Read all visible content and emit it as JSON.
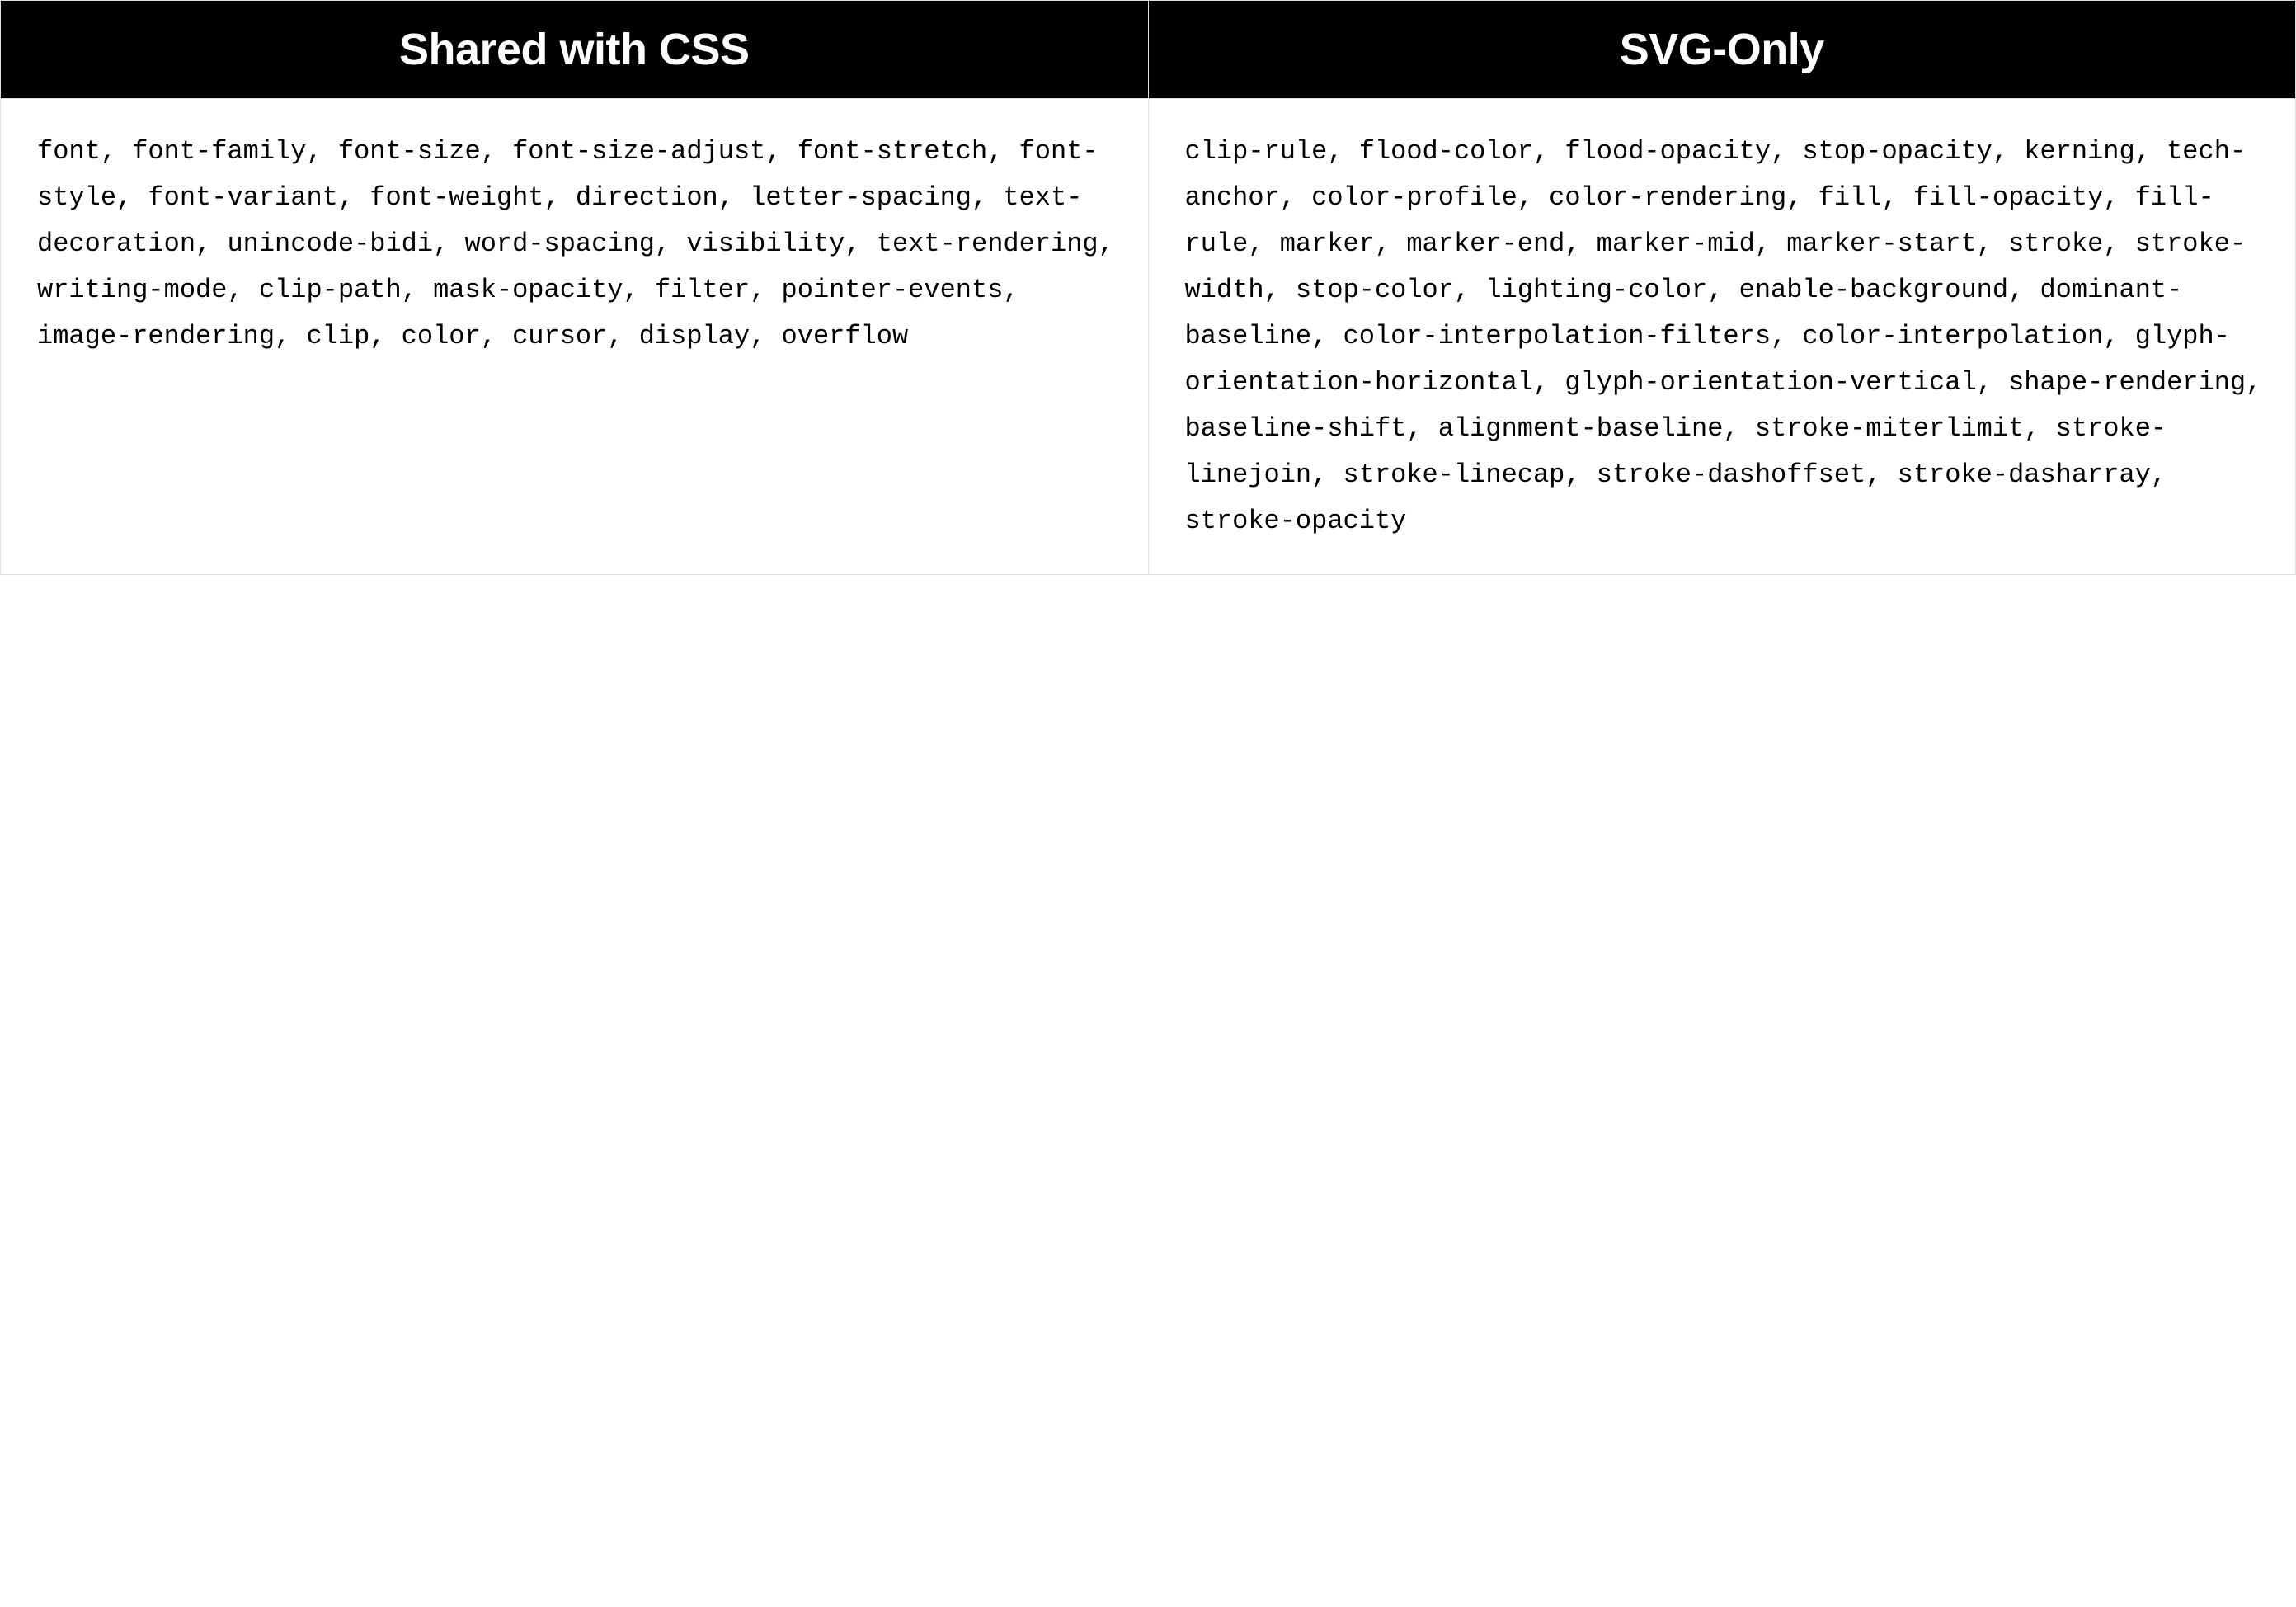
{
  "table": {
    "columns": [
      {
        "header": "Shared with CSS",
        "body": "font, font-family, font-size, font-size-adjust, font-stretch, font-style, font-variant, font-weight, direction, letter-spacing, text-decoration, unincode-bidi, word-spacing, visibility, text-rendering, writing-mode, clip-path, mask-opacity, filter, pointer-events, image-rendering, clip, color, cursor, display, overflow"
      },
      {
        "header": "SVG-Only",
        "body": "clip-rule, flood-color, flood-opacity, stop-opacity, kerning, tech-anchor, color-profile, color-rendering, fill, fill-opacity, fill-rule, marker, marker-end, marker-mid, marker-start, stroke, stroke-width, stop-color, lighting-color, enable-background, dominant-baseline, color-interpolation-filters, color-interpolation, glyph-orientation-horizontal, glyph-orientation-vertical, shape-rendering, baseline-shift, alignment-baseline, stroke-miterlimit, stroke-linejoin, stroke-linecap, stroke-dashoffset, stroke-dasharray, stroke-opacity"
      }
    ]
  }
}
